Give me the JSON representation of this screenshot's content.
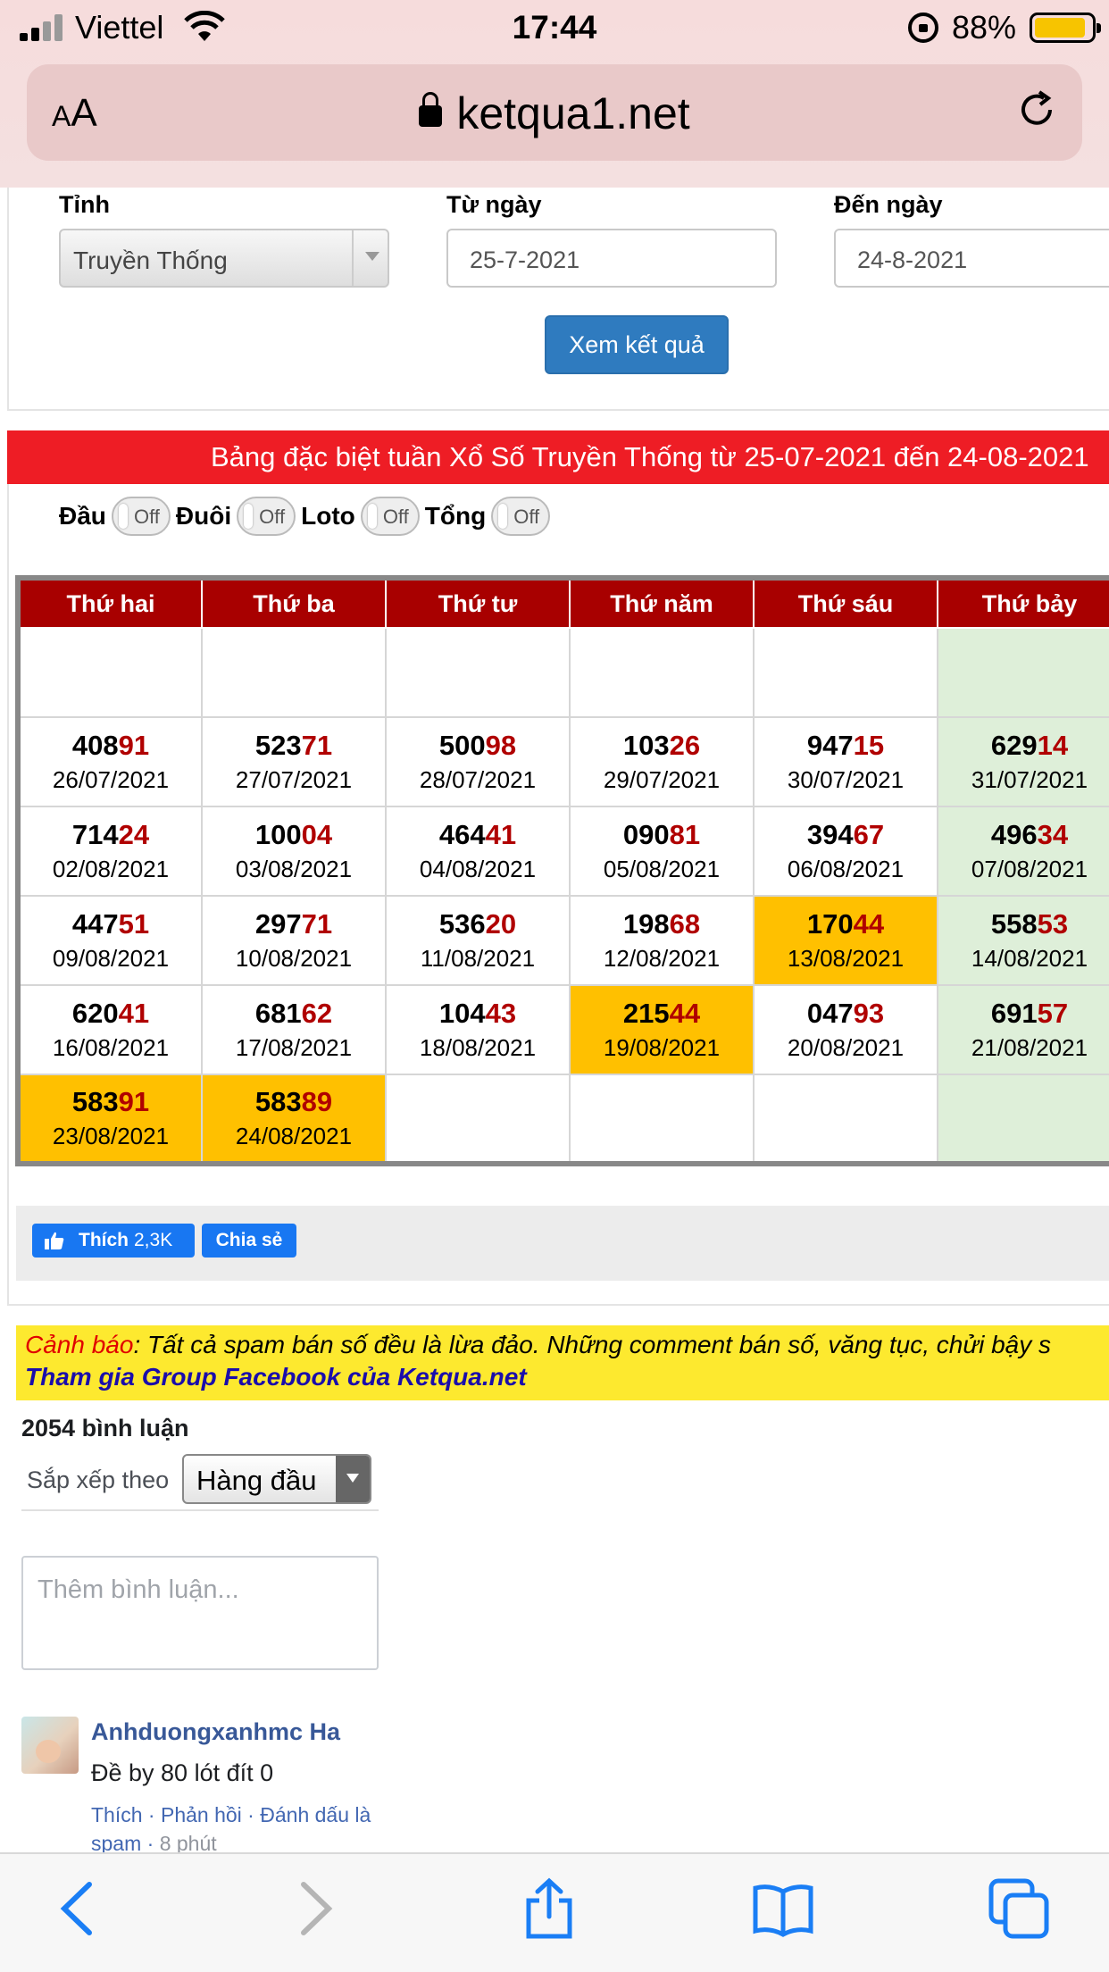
{
  "status_bar": {
    "carrier": "Viettel",
    "time": "17:44",
    "battery": "88%"
  },
  "browser": {
    "text_size_label": "AA",
    "url": "ketqua1.net"
  },
  "form": {
    "province_label": "Tỉnh",
    "province_value": "Truyền Thống",
    "from_label": "Từ ngày",
    "from_value": "25-7-2021",
    "to_label": "Đến ngày",
    "to_value": "24-8-2021",
    "submit_label": "Xem kết quả"
  },
  "results": {
    "title": "Bảng đặc biệt tuần Xổ Số Truyền Thống từ 25-07-2021 đến 24-08-2021",
    "toggles": [
      {
        "label": "Đầu",
        "state": "Off"
      },
      {
        "label": "Đuôi",
        "state": "Off"
      },
      {
        "label": "Loto",
        "state": "Off"
      },
      {
        "label": "Tổng",
        "state": "Off"
      }
    ],
    "days": [
      "Thứ hai",
      "Thứ ba",
      "Thứ tư",
      "Thứ năm",
      "Thứ sáu",
      "Thứ bảy"
    ],
    "rows": [
      [
        {
          "head": "408",
          "tail": "91",
          "date": "26/07/2021"
        },
        {
          "head": "523",
          "tail": "71",
          "date": "27/07/2021"
        },
        {
          "head": "500",
          "tail": "98",
          "date": "28/07/2021"
        },
        {
          "head": "103",
          "tail": "26",
          "date": "29/07/2021"
        },
        {
          "head": "947",
          "tail": "15",
          "date": "30/07/2021"
        },
        {
          "head": "629",
          "tail": "14",
          "date": "31/07/2021"
        }
      ],
      [
        {
          "head": "714",
          "tail": "24",
          "date": "02/08/2021"
        },
        {
          "head": "100",
          "tail": "04",
          "date": "03/08/2021"
        },
        {
          "head": "464",
          "tail": "41",
          "date": "04/08/2021"
        },
        {
          "head": "090",
          "tail": "81",
          "date": "05/08/2021"
        },
        {
          "head": "394",
          "tail": "67",
          "date": "06/08/2021"
        },
        {
          "head": "496",
          "tail": "34",
          "date": "07/08/2021"
        }
      ],
      [
        {
          "head": "447",
          "tail": "51",
          "date": "09/08/2021"
        },
        {
          "head": "297",
          "tail": "71",
          "date": "10/08/2021"
        },
        {
          "head": "536",
          "tail": "20",
          "date": "11/08/2021"
        },
        {
          "head": "198",
          "tail": "68",
          "date": "12/08/2021"
        },
        {
          "head": "170",
          "tail": "44",
          "date": "13/08/2021",
          "highlight": true
        },
        {
          "head": "558",
          "tail": "53",
          "date": "14/08/2021"
        }
      ],
      [
        {
          "head": "620",
          "tail": "41",
          "date": "16/08/2021"
        },
        {
          "head": "681",
          "tail": "62",
          "date": "17/08/2021"
        },
        {
          "head": "104",
          "tail": "43",
          "date": "18/08/2021"
        },
        {
          "head": "215",
          "tail": "44",
          "date": "19/08/2021",
          "highlight": true
        },
        {
          "head": "047",
          "tail": "93",
          "date": "20/08/2021"
        },
        {
          "head": "691",
          "tail": "57",
          "date": "21/08/2021"
        }
      ],
      [
        {
          "head": "583",
          "tail": "91",
          "date": "23/08/2021",
          "highlight": true
        },
        {
          "head": "583",
          "tail": "89",
          "date": "24/08/2021",
          "highlight": true
        },
        null,
        null,
        null,
        null
      ]
    ],
    "colors": {
      "header_bg": "#a80000",
      "tail": "#b00000",
      "highlight": "#ffc000",
      "saturday_bg": "#deefd9",
      "title_bar": "#ee1d25"
    }
  },
  "social": {
    "like_label": "Thích",
    "like_count": "2,3K",
    "share_label": "Chia sẻ"
  },
  "comments": {
    "warning_prefix": "Cảnh báo",
    "warning_text": ": Tất cả spam bán số đều là lừa đảo. Những comment bán số, văng tục, chửi bậy s",
    "group_link": "Tham gia Group Facebook của Ketqua.net",
    "count": "2054 bình luận",
    "sort_label": "Sắp xếp theo",
    "sort_value": "Hàng đầu",
    "input_placeholder": "Thêm bình luận...",
    "items": [
      {
        "author": "Anhduongxanhmc Ha",
        "text": "Đề by 80 lót đít 0",
        "like": "Thích",
        "reply": "Phản hồi",
        "spam": "Đánh dấu là spam",
        "time": "8 phút"
      }
    ]
  },
  "toolbar": {
    "icons": [
      "back-icon",
      "forward-icon",
      "share-icon",
      "bookmarks-icon",
      "tabs-icon"
    ]
  }
}
